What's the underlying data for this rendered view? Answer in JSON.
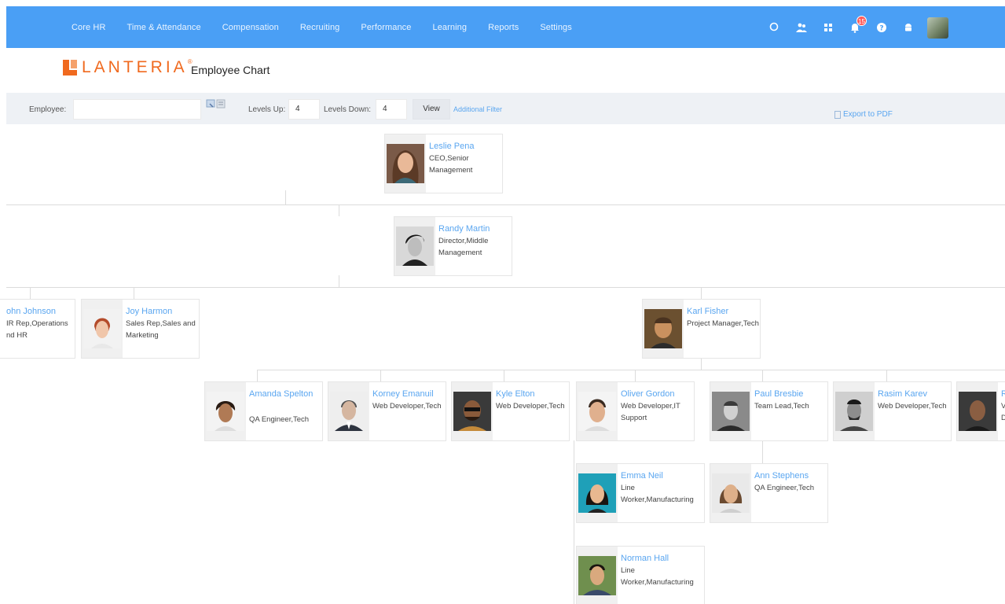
{
  "nav": {
    "items": [
      "Core HR",
      "Time & Attendance",
      "Compensation",
      "Recruiting",
      "Performance",
      "Learning",
      "Reports",
      "Settings"
    ],
    "bell_badge": "15",
    "icons": [
      "search-icon",
      "people-icon",
      "apps-icon",
      "bell-icon",
      "help-icon",
      "android-icon",
      "user-avatar"
    ]
  },
  "brand": {
    "logo_text": "LANTERIA",
    "logo_mark": "®"
  },
  "page": {
    "title": "Employee Chart"
  },
  "filter": {
    "employee_label": "Employee:",
    "employee_value": "",
    "levels_up_label": "Levels Up:",
    "levels_up_value": "4",
    "levels_down_label": "Levels Down:",
    "levels_down_value": "4",
    "view_button": "View",
    "additional_filter": "Additional Filter",
    "export": "Export to PDF"
  },
  "colors": {
    "topbar": "#4a9ff5",
    "accent_link": "#5aa6f0",
    "logo": "#f06a1f"
  },
  "employees": {
    "leslie": {
      "name": "Leslie Pena",
      "title": "CEO,Senior Management"
    },
    "randy": {
      "name": "Randy Martin",
      "title": "Director,Middle Management"
    },
    "john": {
      "name": "ohn Johnson",
      "title": "IR Rep,Operations nd HR"
    },
    "joy": {
      "name": "Joy Harmon",
      "title": "Sales Rep,Sales and Marketing"
    },
    "karl": {
      "name": "Karl Fisher",
      "title": "Project Manager,Tech"
    },
    "amanda": {
      "name": "Amanda Spelton",
      "title": "QA Engineer,Tech"
    },
    "korney": {
      "name": "Korney Emanuil",
      "title": "Web Developer,Tech"
    },
    "kyle": {
      "name": "Kyle Elton",
      "title": "Web Developer,Tech"
    },
    "oliver": {
      "name": "Oliver Gordon",
      "title": "Web Developer,IT Support"
    },
    "paul": {
      "name": "Paul Bresbie",
      "title": "Team Lead,Tech"
    },
    "rasim": {
      "name": "Rasim Karev",
      "title": "Web Developer,Tech"
    },
    "cut": {
      "name": "R",
      "title": "V D"
    },
    "emma": {
      "name": "Emma Neil",
      "title": "Line Worker,Manufacturing"
    },
    "ann": {
      "name": "Ann Stephens",
      "title": "QA Engineer,Tech"
    },
    "norman": {
      "name": "Norman Hall",
      "title": "Line Worker,Manufacturing"
    }
  }
}
